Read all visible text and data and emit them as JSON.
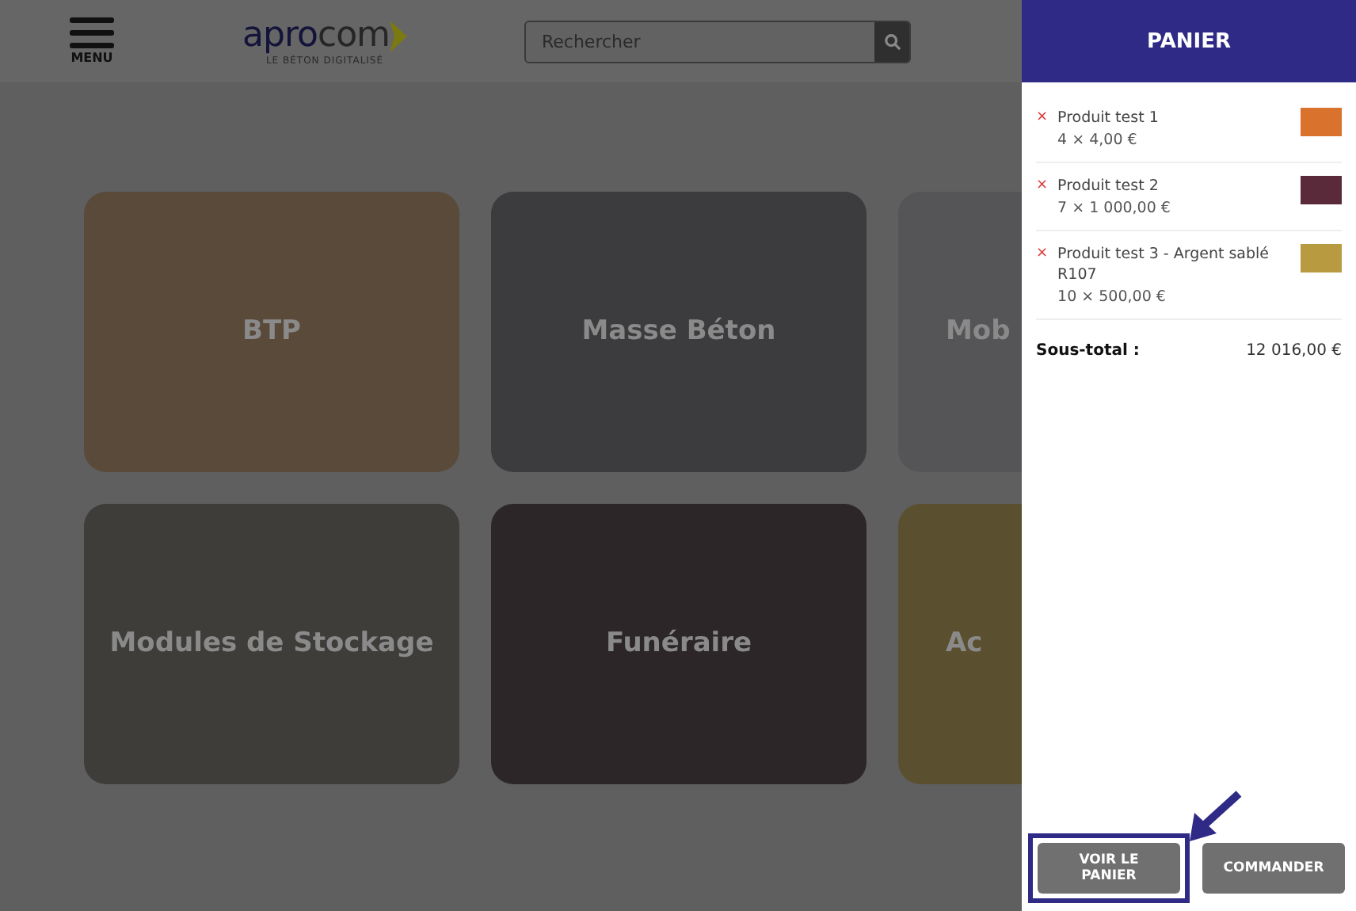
{
  "header": {
    "menu_label": "MENU",
    "logo": {
      "part_1": "apro",
      "part_2": "com",
      "tagline": "LE BÉTON DIGITALISÉ"
    },
    "search": {
      "placeholder": "Rechercher"
    }
  },
  "categories": [
    {
      "label": "BTP",
      "kind": "full",
      "color": "#5a4a3a"
    },
    {
      "label": "Masse Béton",
      "kind": "full",
      "color": "#3c3c3e"
    },
    {
      "label": "Mob",
      "kind": "cut",
      "color": "#555558"
    },
    {
      "label": "Modules de Stockage",
      "kind": "full",
      "color": "#3e3d3a"
    },
    {
      "label": "Funéraire",
      "kind": "full",
      "color": "#2c2628"
    },
    {
      "label": "Ac",
      "kind": "cut",
      "color": "#5a5030"
    }
  ],
  "cart": {
    "title": "PANIER",
    "items": [
      {
        "remove_symbol": "×",
        "name": "Produit test 1",
        "quantity": "4 × 4,00 €",
        "color": "#d9722c"
      },
      {
        "remove_symbol": "×",
        "name": "Produit test 2",
        "quantity": "7 × 1 000,00 €",
        "color": "#5a2a3a"
      },
      {
        "remove_symbol": "×",
        "name": "Produit test 3 - Argent sablé R107",
        "quantity": "10 × 500,00 €",
        "color": "#b89a40"
      }
    ],
    "subtotal_label": "Sous-total :",
    "subtotal_value": "12 016,00 €",
    "buttons": [
      {
        "label": "VOIR LE PANIER",
        "highlighted": true
      },
      {
        "label": "COMMANDER",
        "highlighted": false
      }
    ]
  }
}
